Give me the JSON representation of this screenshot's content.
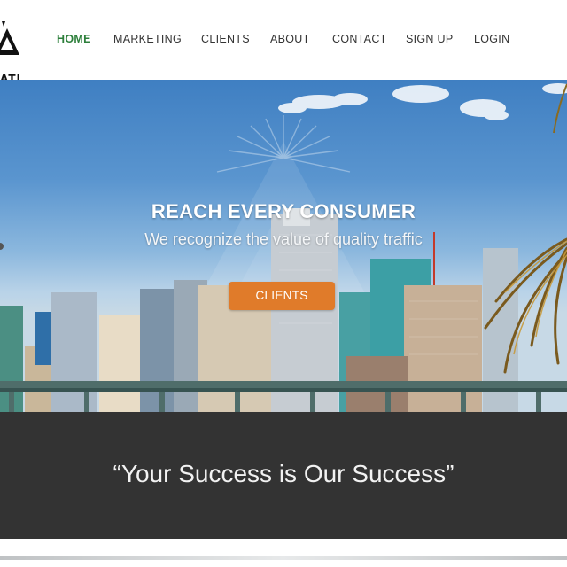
{
  "brand": {
    "logo_text": "ATI"
  },
  "nav": {
    "items": [
      {
        "label": "HOME",
        "active": true
      },
      {
        "label": "MARKETING"
      },
      {
        "label": "CLIENTS"
      },
      {
        "label": "ABOUT"
      },
      {
        "label": "CONTACT"
      },
      {
        "label": "SIGN UP"
      },
      {
        "label": "LOGIN"
      }
    ]
  },
  "hero": {
    "title": "REACH EVERY CONSUMER",
    "subtitle": "We recognize the value of quality traffic",
    "button_label": "CLIENTS"
  },
  "quote": {
    "text": "“Your Success is Our Success”"
  },
  "colors": {
    "active_nav": "#2d7f3b",
    "button": "#e07b2a",
    "band": "#333333"
  }
}
